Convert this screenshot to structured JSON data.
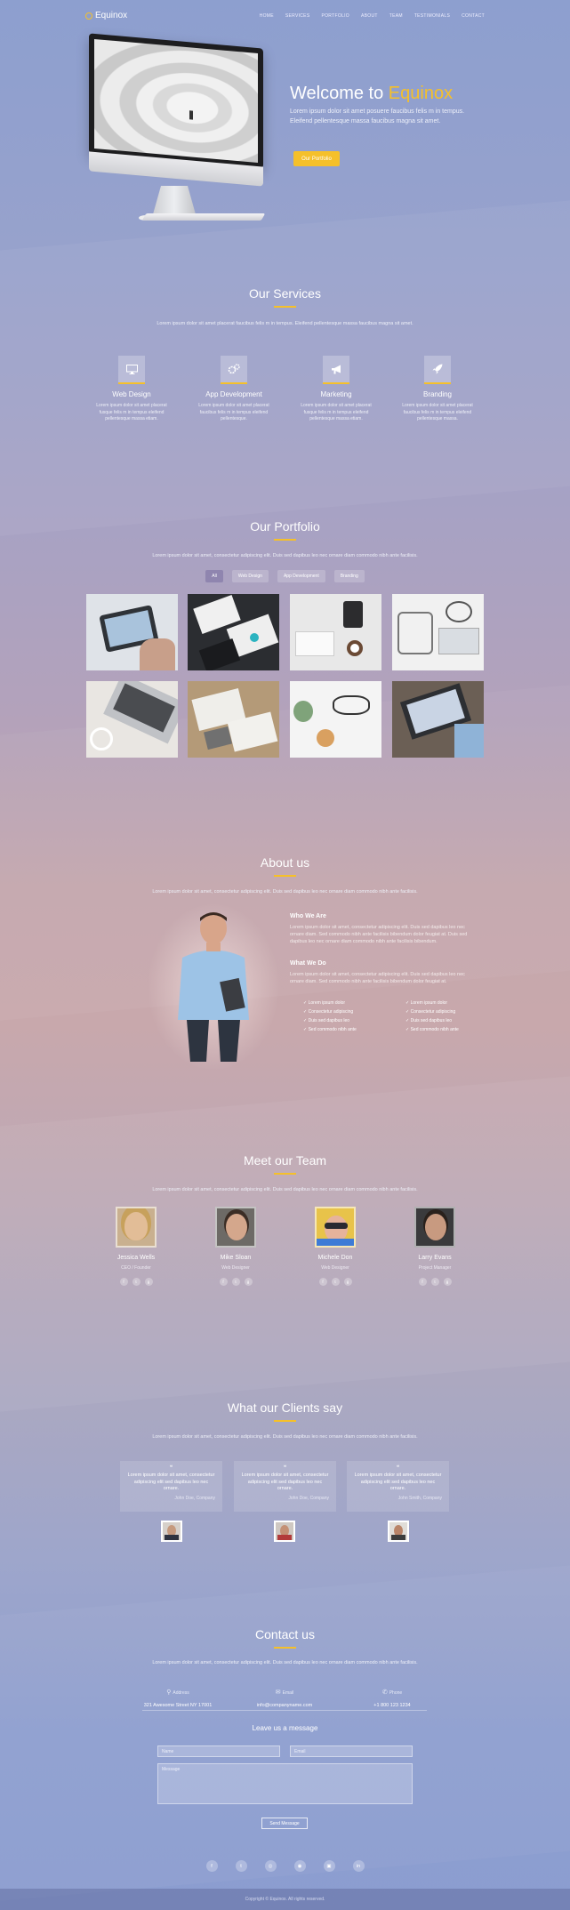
{
  "nav": {
    "logo": "Equinox",
    "items": [
      "HOME",
      "SERVICES",
      "PORTFOLIO",
      "ABOUT",
      "TEAM",
      "TESTIMONIALS",
      "CONTACT"
    ]
  },
  "hero": {
    "title_prefix": "Welcome to",
    "title_accent": "Equinox",
    "subtitle": "Lorem ipsum dolor sit amet posuere faucibus felis m in tempus. Eleifend pellentesque massa faucibus magna sit amet.",
    "button": "Our Portfolio"
  },
  "services": {
    "title": "Our Services",
    "description": "Lorem ipsum dolor sit amet placerat faucibus felis m in tempus. Eleifend pellentesque massa faucibus magna sit amet.",
    "items": [
      {
        "icon": "monitor-icon",
        "title": "Web Design",
        "text": "Lorem ipsum dolor sit amet placerat fusque felis m in tempus eleifend pellentesque massa etiam."
      },
      {
        "icon": "gears-icon",
        "title": "App Development",
        "text": "Lorem ipsum dolor sit amet placerat faucibus felis m in tempus eleifend pellentesque."
      },
      {
        "icon": "megaphone-icon",
        "title": "Marketing",
        "text": "Lorem ipsum dolor sit amet placerat fusque felis m in tempus eleifend pellentesque massa etiam."
      },
      {
        "icon": "rocket-icon",
        "title": "Branding",
        "text": "Lorem ipsum dolor sit amet placerat faucibus felis m in tempus eleifend pellentesque massa."
      }
    ]
  },
  "portfolio": {
    "title": "Our Portfolio",
    "description": "Lorem ipsum dolor sit amet, consectetur adipiscing elit. Duis sed dapibus leo nec ornare diam commodo nibh ante facilisis.",
    "filters": [
      "All",
      "Web Design",
      "App Development",
      "Branding"
    ],
    "active_filter": "All"
  },
  "about": {
    "title": "About us",
    "description": "Lorem ipsum dolor sit amet, consectetur adipiscing elit. Duis sed dapibus leo nec ornare diam commodo nibh ante facilisis.",
    "who_title": "Who We Are",
    "who_text": "Lorem ipsum dolor sit amet, consectetur adipiscing elit. Duis sed dapibus leo nec ornare diam. Sed commodo nibh ante facilisis bibendum dolor feugiat at. Duis sed dapibus leo nec ornare diam commodo nibh ante facilisis bibendum.",
    "what_title": "What We Do",
    "what_text": "Lorem ipsum dolor sit amet, consectetur adipiscing elit. Duis sed dapibus leo nec ornare diam. Sed commodo nibh ante facilisis bibendum dolor feugiat at.",
    "list_left": [
      "Lorem ipsum dolor",
      "Consectetur adipiscing",
      "Duis sed dapibus leo",
      "Sed commodo nibh ante"
    ],
    "list_right": [
      "Lorem ipsum dolor",
      "Consectetur adipiscing",
      "Duis sed dapibus leo",
      "Sed commodo nibh ante"
    ]
  },
  "team": {
    "title": "Meet our Team",
    "description": "Lorem ipsum dolor sit amet, consectetur adipiscing elit. Duis sed dapibus leo nec ornare diam commodo nibh ante facilisis.",
    "members": [
      {
        "name": "Jessica Wells",
        "role": "CEO / Founder"
      },
      {
        "name": "Mike Sloan",
        "role": "Web Designer"
      },
      {
        "name": "Michele Don",
        "role": "Web Designer"
      },
      {
        "name": "Larry Evans",
        "role": "Project Manager"
      }
    ]
  },
  "testimonials": {
    "title": "What our Clients say",
    "description": "Lorem ipsum dolor sit amet, consectetur adipiscing elit. Duis sed dapibus leo nec ornare diam commodo nibh ante facilisis.",
    "items": [
      {
        "text": "Lorem ipsum dolor sit amet, consectetur adipiscing elit sed dapibus leo nec ornare.",
        "author": "John Doe, Company"
      },
      {
        "text": "Lorem ipsum dolor sit amet, consectetur adipiscing elit sed dapibus leo nec ornare.",
        "author": "John Doe, Company"
      },
      {
        "text": "Lorem ipsum dolor sit amet, consectetur adipiscing elit sed dapibus leo nec ornare.",
        "author": "John Smith, Company"
      }
    ]
  },
  "contact": {
    "title": "Contact us",
    "description": "Lorem ipsum dolor sit amet, consectetur adipiscing elit. Duis sed dapibus leo nec ornare diam commodo nibh ante facilisis.",
    "address_label": "Address",
    "address": "321 Awesome Street NY 17001",
    "email_label": "Email",
    "email": "info@companyname.com",
    "phone_label": "Phone",
    "phone": "+1 800 123 1234",
    "form_title": "Leave us a message",
    "name_placeholder": "Name",
    "email_placeholder": "Email",
    "message_placeholder": "Message",
    "send_button": "Send Message"
  },
  "footer": {
    "copyright": "Copyright © Equinox. All rights reserved."
  },
  "colors": {
    "accent": "#f5c02a"
  }
}
